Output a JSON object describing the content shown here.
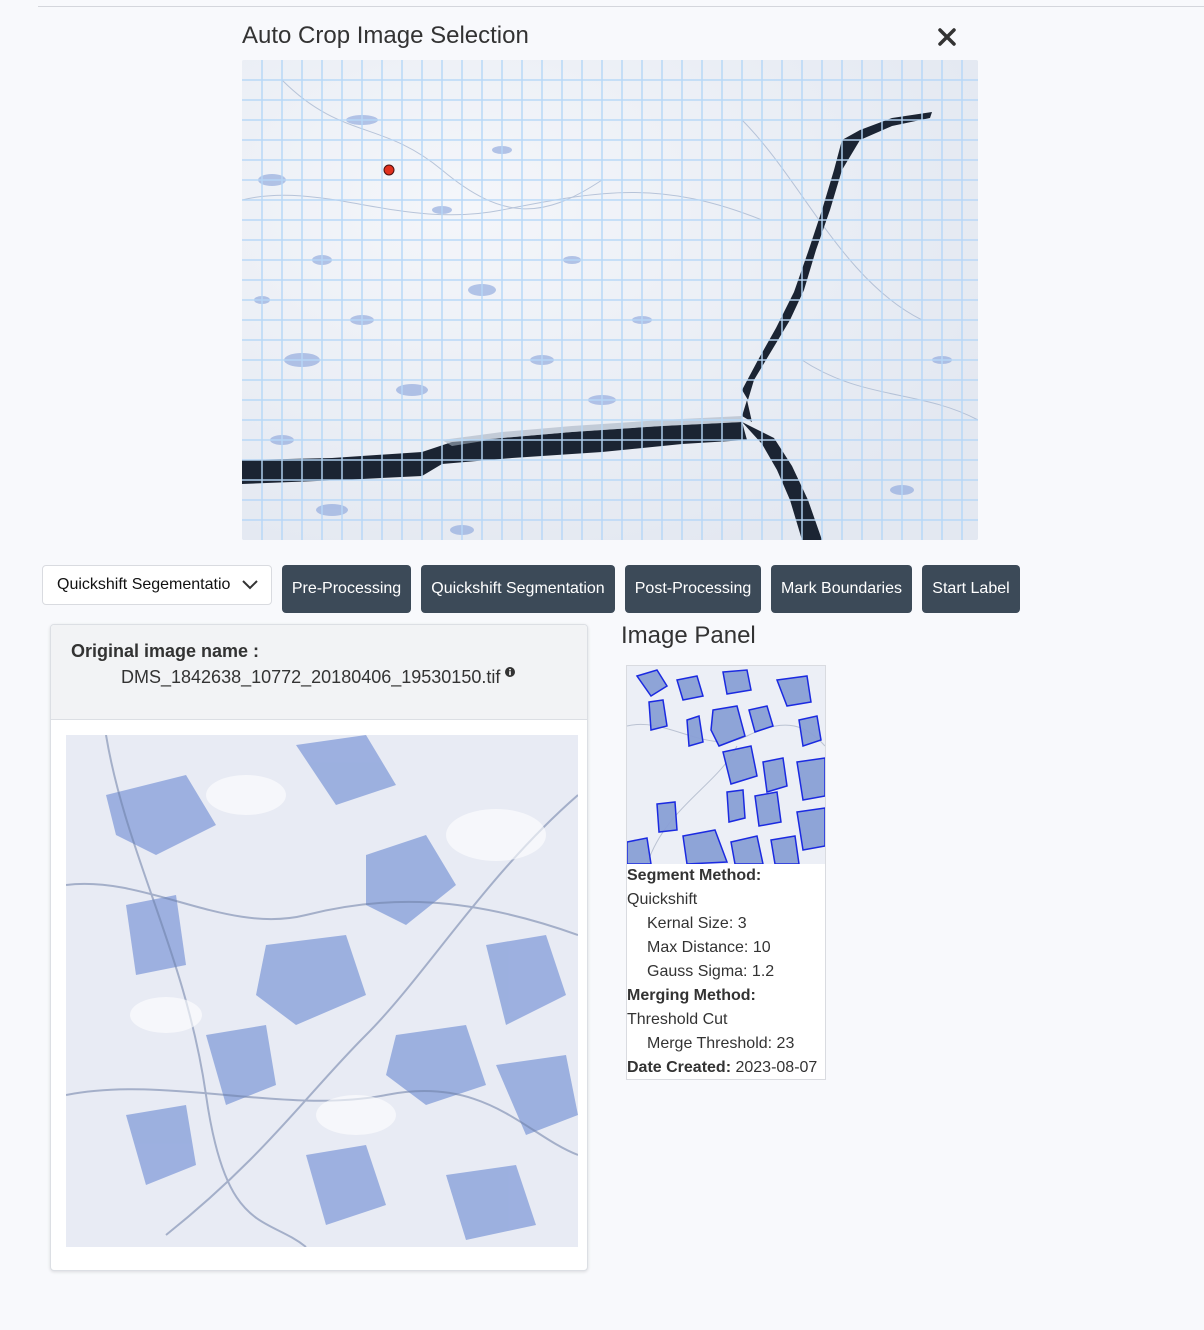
{
  "modal": {
    "title": "Auto Crop Image Selection",
    "close_icon": "close-icon"
  },
  "controls": {
    "select_value": "Quickshift Segementatio",
    "buttons": [
      "Pre-Processing",
      "Quickshift Segmentation",
      "Post-Processing",
      "Mark Boundaries",
      "Start Label"
    ]
  },
  "original": {
    "label": "Original image name :",
    "filename": "DMS_1842638_10772_20180406_19530150.tif"
  },
  "image_panel": {
    "title": "Image Panel",
    "segment_method_label": "Segment Method:",
    "segment_method": "Quickshift",
    "kernel_size": "Kernal Size: 3",
    "max_distance": "Max Distance: 10",
    "gauss_sigma": "Gauss Sigma: 1.2",
    "merging_method_label": "Merging Method:",
    "merging_method": "Threshold Cut",
    "merge_threshold": "Merge Threshold: 23",
    "date_label": "Date Created:",
    "date_value": "2023-08-07"
  },
  "colors": {
    "button_bg": "#3c4a58",
    "grid": "#b6d7f7",
    "boundary": "#1020e0",
    "marker": "#e0301e"
  }
}
